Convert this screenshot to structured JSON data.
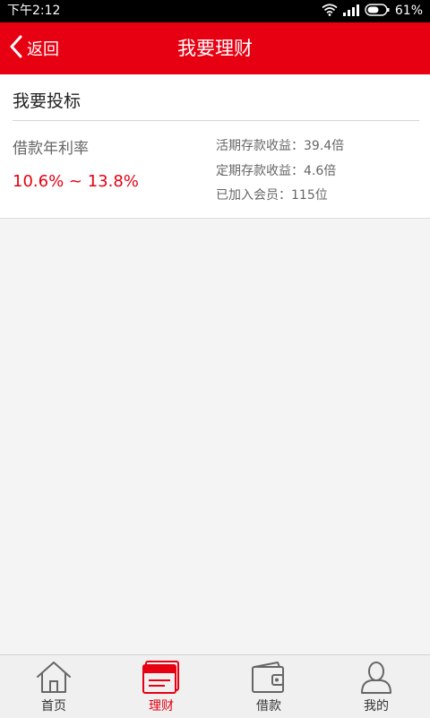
{
  "status_bar": {
    "time": "下午2:12",
    "battery": "61%"
  },
  "header": {
    "back_label": "返回",
    "title": "我要理财"
  },
  "card": {
    "title": "我要投标",
    "rate_label": "借款年利率",
    "rate_value": "10.6% ~ 13.8%",
    "stats": [
      "活期存款收益：39.4倍",
      "定期存款收益：4.6倍",
      "已加入会员：115位"
    ]
  },
  "bottom_nav": {
    "items": [
      {
        "label": "首页",
        "icon": "home-icon"
      },
      {
        "label": "理财",
        "icon": "finance-icon",
        "active": true
      },
      {
        "label": "借款",
        "icon": "wallet-icon"
      },
      {
        "label": "我的",
        "icon": "user-icon"
      }
    ]
  },
  "colors": {
    "accent": "#e60012",
    "nav_inactive": "#666666"
  }
}
